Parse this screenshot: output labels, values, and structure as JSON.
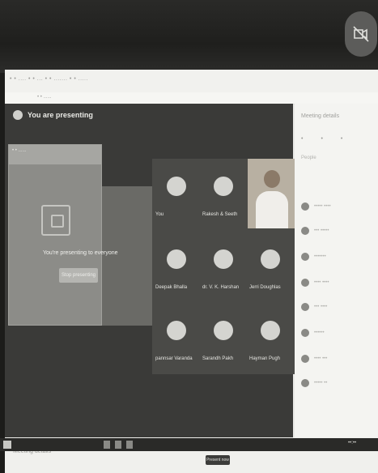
{
  "browser": {
    "url_text": "• • ....  • • ...  • • .......  • • .....",
    "bookmark_text": "• • ......"
  },
  "stage": {
    "presenting_title": "You are presenting",
    "share_message": "You're presenting to everyone",
    "stop_label": "Stop presenting",
    "tiles": [
      {
        "name": "You"
      },
      {
        "name": "Rakesh & Seeth"
      },
      {
        "name": "Deepak Bhalla"
      },
      {
        "name": "dr. V. K. Harshan"
      },
      {
        "name": "Jerri Doughlas"
      },
      {
        "name": "pannsar Varanda"
      },
      {
        "name": "Sarandh Pakh"
      },
      {
        "name": "Hayman Pugh"
      }
    ]
  },
  "sidebar": {
    "title": "Meeting details",
    "tabs": [
      "•",
      "•",
      "•"
    ],
    "section_label": "People",
    "people": [
      "••••• ••••",
      "••• •••••",
      "•••••••",
      "•••• ••••",
      "••• ••••",
      "••••••",
      "•••• •••",
      "••••• ••"
    ]
  },
  "bottom": {
    "join_label": "Meeting details",
    "present_now": "Present now"
  },
  "taskbar": {
    "clock": "••:••"
  },
  "colors": {
    "accent": "#3c3c3a"
  }
}
